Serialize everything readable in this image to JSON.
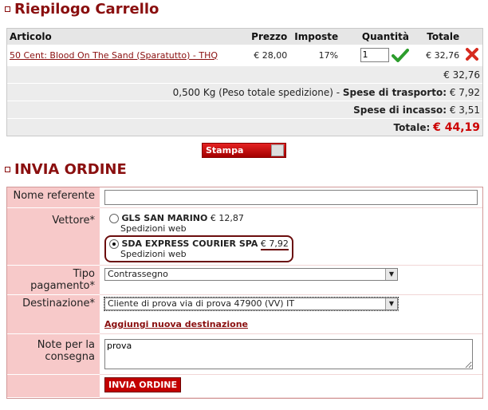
{
  "cart_section": {
    "title": "Riepilogo Carrello"
  },
  "cart": {
    "headers": {
      "item": "Articolo",
      "price": "Prezzo",
      "tax": "Imposte",
      "qty": "Quantità",
      "total": "Totale"
    },
    "items": [
      {
        "name": "50 Cent: Blood On The Sand (Sparatutto) - THQ",
        "price": "€ 28,00",
        "tax": "17%",
        "qty": "1",
        "total": "€ 32,76"
      }
    ],
    "subtotal": "€ 32,76",
    "shipping_weight": "0,500 Kg (Peso totale spedizione)",
    "shipping_label": "Spese di trasporto:",
    "shipping_value": "€ 7,92",
    "cod_label": "Spese di incasso:",
    "cod_value": "€ 3,51",
    "total_label": "Totale:",
    "total_value": "€ 44,19"
  },
  "print_button": {
    "label": "Stampa"
  },
  "order_section": {
    "title": "INVIA ORDINE"
  },
  "order_form": {
    "name_label": "Nome referente",
    "name_value": "",
    "carrier_label": "Vettore*",
    "carriers": [
      {
        "name": "GLS SAN MARINO",
        "price": "€ 12,87",
        "sub": "Spedizioni web",
        "selected": false
      },
      {
        "name": "SDA EXPRESS COURIER SPA",
        "price": "€ 7,92",
        "sub": "Spedizioni web",
        "selected": true
      }
    ],
    "payment_label": "Tipo pagamento*",
    "payment_value": "Contrassegno",
    "destination_label": "Destinazione*",
    "destination_value": "Cliente di prova via di prova 47900 (VV) IT",
    "add_destination": "Aggiungi nuova destinazione",
    "notes_label": "Note per la consegna",
    "notes_value": "prova",
    "submit": "INVIA ORDINE"
  },
  "colors": {
    "brand": "#8a0f0f",
    "accent_red": "#cc0000",
    "label_bg": "#f7c9c9"
  }
}
